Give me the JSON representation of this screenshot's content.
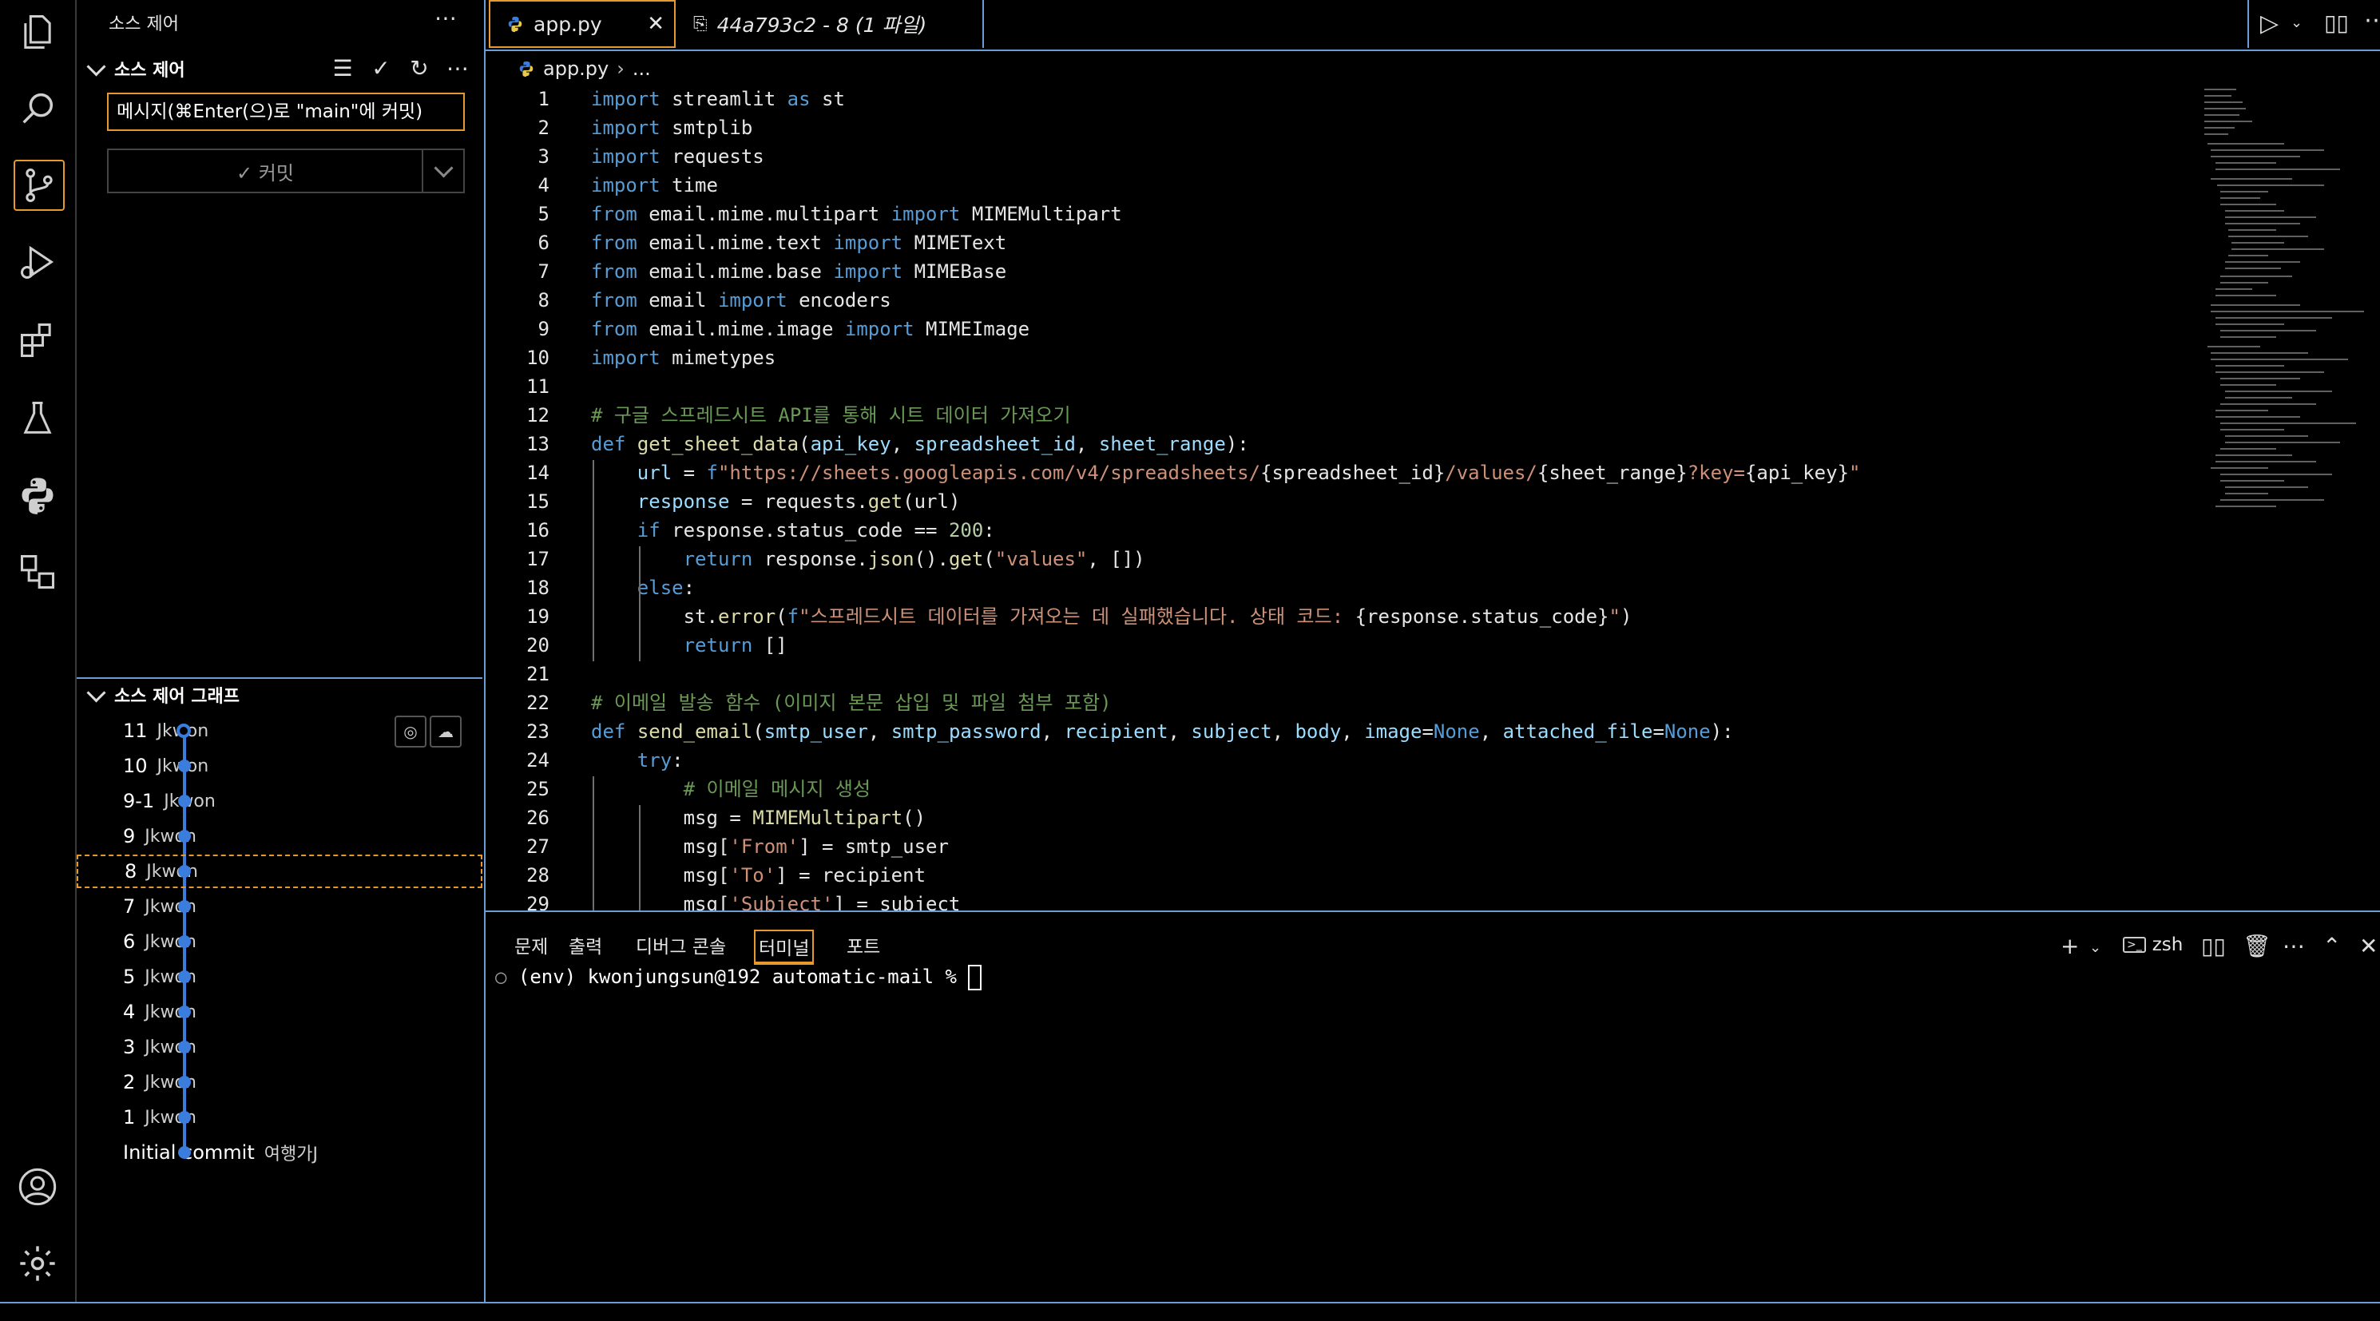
{
  "activity_bar": {
    "items": [
      "explorer-icon",
      "search-icon",
      "source-control-icon",
      "run-debug-icon",
      "extensions-icon",
      "testing-icon",
      "python-icon",
      "remote-explorer-icon"
    ],
    "bottom": [
      "account-icon",
      "settings-gear-icon"
    ]
  },
  "sidebar": {
    "title": "소스 제어",
    "section_title": "소스 제어",
    "commit_placeholder": "메시지(⌘Enter(으)로 \"main\"에 커밋)",
    "commit_button": "✓ 커밋",
    "graph_title": "소스 제어 그래프",
    "graph": [
      {
        "name": "11",
        "author": "Jkwon"
      },
      {
        "name": "10",
        "author": "Jkwon"
      },
      {
        "name": "9-1",
        "author": "Jkwon"
      },
      {
        "name": "9",
        "author": "Jkwon"
      },
      {
        "name": "8",
        "author": "Jkwon"
      },
      {
        "name": "7",
        "author": "Jkwon"
      },
      {
        "name": "6",
        "author": "Jkwon"
      },
      {
        "name": "5",
        "author": "Jkwon"
      },
      {
        "name": "4",
        "author": "Jkwon"
      },
      {
        "name": "3",
        "author": "Jkwon"
      },
      {
        "name": "2",
        "author": "Jkwon"
      },
      {
        "name": "1",
        "author": "Jkwon"
      },
      {
        "name": "Initial commit",
        "author": "여행가J"
      }
    ]
  },
  "tabs": [
    {
      "label": "app.py",
      "active": true
    },
    {
      "label": "44a793c2 - 8 (1 파일)",
      "active": false
    }
  ],
  "breadcrumb": {
    "file": "app.py",
    "rest": "..."
  },
  "code_lines": [
    [
      [
        "kw",
        "import"
      ],
      [
        "pl",
        " streamlit "
      ],
      [
        "kw",
        "as"
      ],
      [
        "pl",
        " st"
      ]
    ],
    [
      [
        "kw",
        "import"
      ],
      [
        "pl",
        " smtplib"
      ]
    ],
    [
      [
        "kw",
        "import"
      ],
      [
        "pl",
        " requests"
      ]
    ],
    [
      [
        "kw",
        "import"
      ],
      [
        "pl",
        " time"
      ]
    ],
    [
      [
        "kw",
        "from"
      ],
      [
        "pl",
        " email.mime.multipart "
      ],
      [
        "kw",
        "import"
      ],
      [
        "pl",
        " MIMEMultipart"
      ]
    ],
    [
      [
        "kw",
        "from"
      ],
      [
        "pl",
        " email.mime.text "
      ],
      [
        "kw",
        "import"
      ],
      [
        "pl",
        " MIMEText"
      ]
    ],
    [
      [
        "kw",
        "from"
      ],
      [
        "pl",
        " email.mime.base "
      ],
      [
        "kw",
        "import"
      ],
      [
        "pl",
        " MIMEBase"
      ]
    ],
    [
      [
        "kw",
        "from"
      ],
      [
        "pl",
        " email "
      ],
      [
        "kw",
        "import"
      ],
      [
        "pl",
        " encoders"
      ]
    ],
    [
      [
        "kw",
        "from"
      ],
      [
        "pl",
        " email.mime.image "
      ],
      [
        "kw",
        "import"
      ],
      [
        "pl",
        " MIMEImage"
      ]
    ],
    [
      [
        "kw",
        "import"
      ],
      [
        "pl",
        " mimetypes"
      ]
    ],
    [],
    [
      [
        "cm",
        "# 구글 스프레드시트 API를 통해 시트 데이터 가져오기"
      ]
    ],
    [
      [
        "kw",
        "def"
      ],
      [
        "pl",
        " "
      ],
      [
        "fn",
        "get_sheet_data"
      ],
      [
        "pl",
        "("
      ],
      [
        "var",
        "api_key"
      ],
      [
        "pl",
        ", "
      ],
      [
        "var",
        "spreadsheet_id"
      ],
      [
        "pl",
        ", "
      ],
      [
        "var",
        "sheet_range"
      ],
      [
        "pl",
        "):"
      ]
    ],
    [
      [
        "pl",
        "    "
      ],
      [
        "var",
        "url"
      ],
      [
        "pl",
        " = "
      ],
      [
        "kw",
        "f"
      ],
      [
        "str",
        "\"https://sheets.googleapis.com/v4/spreadsheets/"
      ],
      [
        "pl",
        "{spreadsheet_id}"
      ],
      [
        "str",
        "/values/"
      ],
      [
        "pl",
        "{sheet_range}"
      ],
      [
        "str",
        "?key="
      ],
      [
        "pl",
        "{api_key}"
      ],
      [
        "str",
        "\""
      ]
    ],
    [
      [
        "pl",
        "    "
      ],
      [
        "var",
        "response"
      ],
      [
        "pl",
        " = requests."
      ],
      [
        "fn",
        "get"
      ],
      [
        "pl",
        "(url)"
      ]
    ],
    [
      [
        "pl",
        "    "
      ],
      [
        "kw",
        "if"
      ],
      [
        "pl",
        " response.status_code == "
      ],
      [
        "num2",
        "200"
      ],
      [
        "pl",
        ":"
      ]
    ],
    [
      [
        "pl",
        "        "
      ],
      [
        "kw",
        "return"
      ],
      [
        "pl",
        " response."
      ],
      [
        "fn",
        "json"
      ],
      [
        "pl",
        "()."
      ],
      [
        "fn",
        "get"
      ],
      [
        "pl",
        "("
      ],
      [
        "str",
        "\"values\""
      ],
      [
        "pl",
        ", [])"
      ]
    ],
    [
      [
        "pl",
        "    "
      ],
      [
        "kw",
        "else"
      ],
      [
        "pl",
        ":"
      ]
    ],
    [
      [
        "pl",
        "        st."
      ],
      [
        "fn",
        "error"
      ],
      [
        "pl",
        "("
      ],
      [
        "kw",
        "f"
      ],
      [
        "str",
        "\"스프레드시트 데이터를 가져오는 데 실패했습니다. 상태 코드: "
      ],
      [
        "pl",
        "{response.status_code}"
      ],
      [
        "str",
        "\""
      ],
      [
        "pl",
        ")"
      ]
    ],
    [
      [
        "pl",
        "        "
      ],
      [
        "kw",
        "return"
      ],
      [
        "pl",
        " []"
      ]
    ],
    [],
    [
      [
        "cm",
        "# 이메일 발송 함수 (이미지 본문 삽입 및 파일 첨부 포함)"
      ]
    ],
    [
      [
        "kw",
        "def"
      ],
      [
        "pl",
        " "
      ],
      [
        "fn",
        "send_email"
      ],
      [
        "pl",
        "("
      ],
      [
        "var",
        "smtp_user"
      ],
      [
        "pl",
        ", "
      ],
      [
        "var",
        "smtp_password"
      ],
      [
        "pl",
        ", "
      ],
      [
        "var",
        "recipient"
      ],
      [
        "pl",
        ", "
      ],
      [
        "var",
        "subject"
      ],
      [
        "pl",
        ", "
      ],
      [
        "var",
        "body"
      ],
      [
        "pl",
        ", "
      ],
      [
        "var",
        "image"
      ],
      [
        "pl",
        "="
      ],
      [
        "kw",
        "None"
      ],
      [
        "pl",
        ", "
      ],
      [
        "var",
        "attached_file"
      ],
      [
        "pl",
        "="
      ],
      [
        "kw",
        "None"
      ],
      [
        "pl",
        "):"
      ]
    ],
    [
      [
        "pl",
        "    "
      ],
      [
        "kw",
        "try"
      ],
      [
        "pl",
        ":"
      ]
    ],
    [
      [
        "pl",
        "        "
      ],
      [
        "cm",
        "# 이메일 메시지 생성"
      ]
    ],
    [
      [
        "pl",
        "        msg = "
      ],
      [
        "fn",
        "MIMEMultipart"
      ],
      [
        "pl",
        "()"
      ]
    ],
    [
      [
        "pl",
        "        msg["
      ],
      [
        "str",
        "'From'"
      ],
      [
        "pl",
        "] = smtp_user"
      ]
    ],
    [
      [
        "pl",
        "        msg["
      ],
      [
        "str",
        "'To'"
      ],
      [
        "pl",
        "] = recipient"
      ]
    ],
    [
      [
        "pl",
        "        msg["
      ],
      [
        "str",
        "'Subject'"
      ],
      [
        "pl",
        "] = subject"
      ]
    ]
  ],
  "panel": {
    "tabs": [
      "문제",
      "출력",
      "디버그 콘솔",
      "터미널",
      "포트"
    ],
    "active_tab": "터미널",
    "shell_label": "zsh",
    "terminal_prompt": "(env) kwonjungsun@192 automatic-mail % "
  },
  "colors": {
    "accent": "#e69a2e",
    "border": "#6b9ed6",
    "graph": "#3b7ddd"
  }
}
